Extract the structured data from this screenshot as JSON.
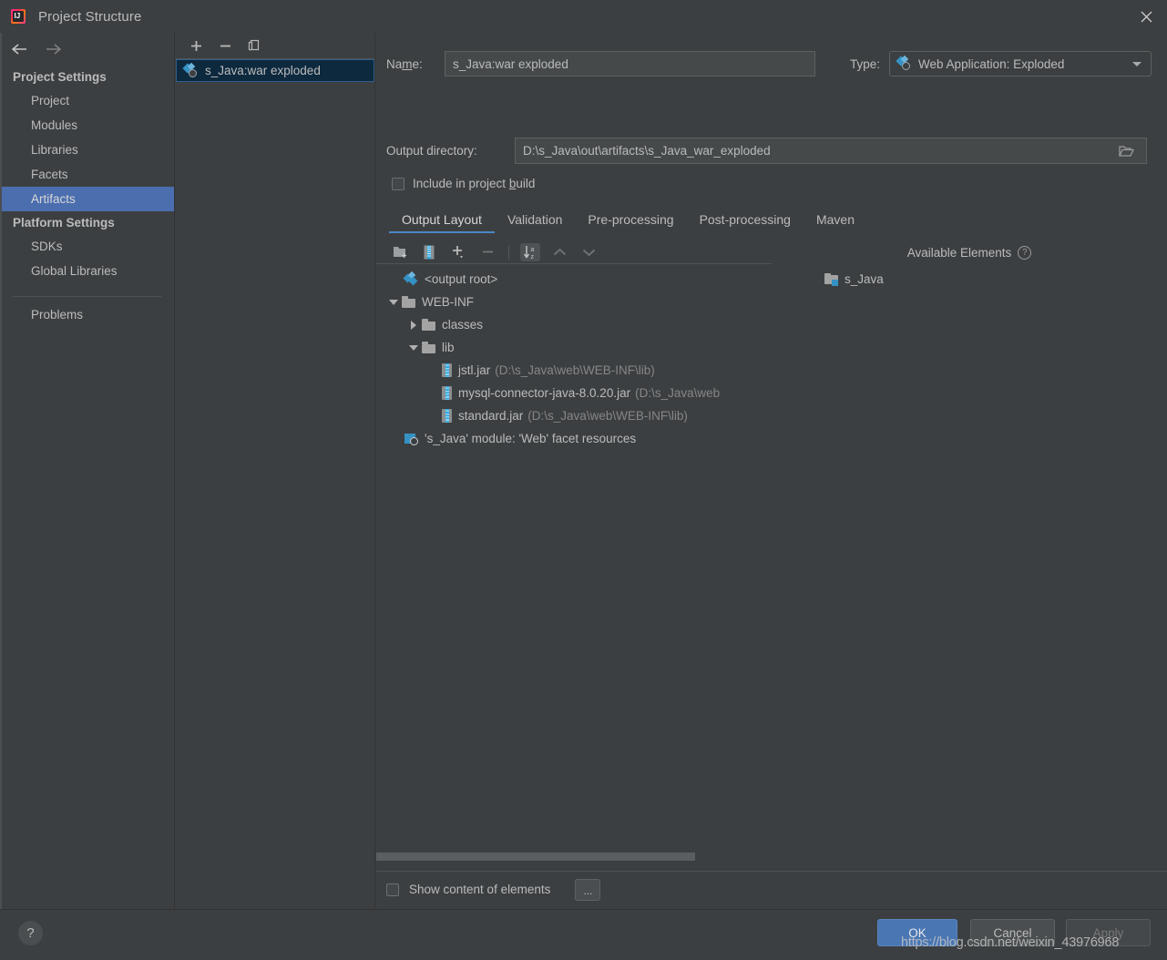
{
  "window": {
    "title": "Project Structure",
    "app_icon": "intellij-idea-icon",
    "close_label": "×"
  },
  "sidebar": {
    "back_icon": "arrow-left-icon",
    "forward_icon": "arrow-right-icon",
    "groups": [
      {
        "title": "Project Settings",
        "items": [
          {
            "label": "Project",
            "selected": false
          },
          {
            "label": "Modules",
            "selected": false
          },
          {
            "label": "Libraries",
            "selected": false
          },
          {
            "label": "Facets",
            "selected": false
          },
          {
            "label": "Artifacts",
            "selected": true
          }
        ]
      },
      {
        "title": "Platform Settings",
        "items": [
          {
            "label": "SDKs",
            "selected": false
          },
          {
            "label": "Global Libraries",
            "selected": false
          }
        ]
      }
    ],
    "problems_label": "Problems"
  },
  "artifacts_panel": {
    "toolbar": [
      {
        "name": "add-artifact-button",
        "glyph": "+"
      },
      {
        "name": "remove-artifact-button",
        "glyph": "−"
      },
      {
        "name": "copy-artifact-button",
        "glyph": "copy-icon"
      }
    ],
    "items": [
      {
        "label": "s_Java:war exploded",
        "icon": "web-artifact-icon",
        "selected": true
      }
    ]
  },
  "main": {
    "name_label": "Name:",
    "name_value": "s_Java:war exploded",
    "type_label": "Type:",
    "type_value": "Web Application: Exploded",
    "type_icon": "web-artifact-icon",
    "outdir_label": "Output directory:",
    "outdir_value": "D:\\s_Java\\out\\artifacts\\s_Java_war_exploded",
    "outdir_browse_icon": "folder-open-icon",
    "include_label": "Include in project build",
    "include_checked": false,
    "tabs": [
      {
        "label": "Output Layout",
        "active": true
      },
      {
        "label": "Validation",
        "active": false
      },
      {
        "label": "Pre-processing",
        "active": false
      },
      {
        "label": "Post-processing",
        "active": false
      },
      {
        "label": "Maven",
        "active": false
      }
    ],
    "tree_toolbar": [
      {
        "name": "add-directory-button",
        "icon": "folder-add-icon"
      },
      {
        "name": "add-archive-button",
        "icon": "jar-icon"
      },
      {
        "name": "add-copy-button",
        "icon": "plus-dropdown-icon"
      },
      {
        "name": "remove-element-button",
        "icon": "minus-icon"
      },
      {
        "name": "sort-button",
        "icon": "sort-az-icon",
        "pressed": true
      },
      {
        "name": "move-up-button",
        "icon": "triangle-up-icon"
      },
      {
        "name": "move-down-button",
        "icon": "triangle-down-icon"
      }
    ],
    "available_elements_title": "Available Elements",
    "available_help_icon": "question-mark-icon",
    "output_tree": [
      {
        "indent": 0,
        "twist": "none",
        "icon": "output-root-icon",
        "label": "<output root>",
        "path": ""
      },
      {
        "indent": 0,
        "twist": "down",
        "icon": "folder-icon",
        "label": "WEB-INF",
        "path": ""
      },
      {
        "indent": 1,
        "twist": "right",
        "icon": "folder-icon",
        "label": "classes",
        "path": ""
      },
      {
        "indent": 1,
        "twist": "down",
        "icon": "folder-icon",
        "label": "lib",
        "path": ""
      },
      {
        "indent": 2,
        "twist": "none",
        "icon": "jar-icon",
        "label": "jstl.jar",
        "path": "(D:\\s_Java\\web\\WEB-INF\\lib)"
      },
      {
        "indent": 2,
        "twist": "none",
        "icon": "jar-icon",
        "label": "mysql-connector-java-8.0.20.jar",
        "path": "(D:\\s_Java\\web"
      },
      {
        "indent": 2,
        "twist": "none",
        "icon": "jar-icon",
        "label": "standard.jar",
        "path": "(D:\\s_Java\\web\\WEB-INF\\lib)"
      },
      {
        "indent": 0,
        "twist": "none",
        "icon": "module-facet-icon",
        "label": "'s_Java' module: 'Web' facet resources",
        "path": ""
      }
    ],
    "available_tree": [
      {
        "icon": "module-folder-icon",
        "label": "s_Java"
      }
    ],
    "show_content_label": "Show content of elements",
    "show_content_checked": false,
    "dots_button_label": "..."
  },
  "bottom": {
    "help_label": "?",
    "ok_label": "OK",
    "cancel_label": "Cancel",
    "apply_label": "Apply"
  },
  "watermark": {
    "text": "https://blog.csdn.net/weixin_43976968"
  },
  "colors": {
    "window_bg": "#3c3f41",
    "selection_blue": "#4b6eaf",
    "list_selection": "#0d293e",
    "accent_blue": "#4a88c7",
    "ok_button": "#4a76b3",
    "text": "#bbbbbb",
    "muted_text": "#868686"
  }
}
